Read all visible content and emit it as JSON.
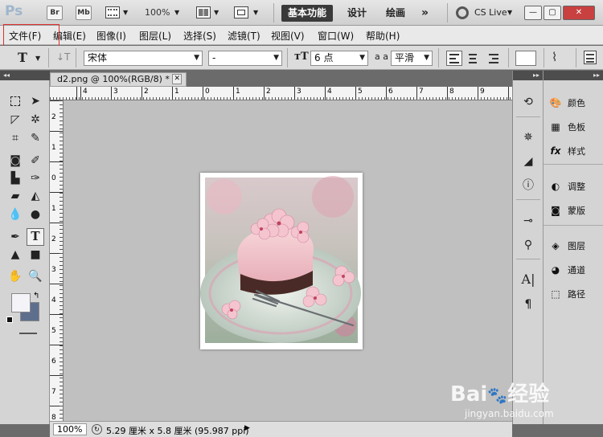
{
  "app": {
    "logo": "Ps",
    "bridge_label": "Br",
    "minibridge_label": "Mb",
    "zoom": "100%",
    "workspaces": [
      "基本功能",
      "设计",
      "绘画"
    ],
    "more": "»",
    "cslive": "CS Live"
  },
  "menu": [
    "文件(F)",
    "编辑(E)",
    "图像(I)",
    "图层(L)",
    "选择(S)",
    "滤镜(T)",
    "视图(V)",
    "窗口(W)",
    "帮助(H)"
  ],
  "options": {
    "tool_glyph": "T",
    "font_family": "宋体",
    "font_style": "-",
    "font_size": "6 点",
    "aa_label": "a a",
    "anti_alias": "平滑"
  },
  "document": {
    "tab_title": "d2.png @ 100%(RGB/8) *",
    "tab_close": "✕",
    "ruler_top_labels": [
      "4",
      "3",
      "2",
      "1",
      "0",
      "1",
      "2",
      "3",
      "4",
      "5",
      "6",
      "7",
      "8",
      "9"
    ],
    "ruler_left_labels": [
      "2",
      "1",
      "0",
      "1",
      "2",
      "3",
      "4",
      "5",
      "6",
      "7",
      "8"
    ]
  },
  "status": {
    "zoom": "100%",
    "size_info": "5.29 厘米 x 5.8 厘米 (95.987 ppi)"
  },
  "panels": [
    {
      "label": "颜色",
      "icon": "color-palette-icon"
    },
    {
      "label": "色板",
      "icon": "swatches-icon"
    },
    {
      "label": "样式",
      "icon": "styles-icon"
    },
    {
      "label": "调整",
      "icon": "adjustments-icon"
    },
    {
      "label": "蒙版",
      "icon": "masks-icon"
    },
    {
      "label": "图层",
      "icon": "layers-icon"
    },
    {
      "label": "通道",
      "icon": "channels-icon"
    },
    {
      "label": "路径",
      "icon": "paths-icon"
    }
  ],
  "watermark": {
    "brand": "Bai",
    "brand2": "经验",
    "url": "jingyan.baidu.com"
  },
  "colors": {
    "workspace_active": "#3a3a3a",
    "menu_highlight": "#e03030",
    "canvas_bg": "#c0c0c0"
  }
}
